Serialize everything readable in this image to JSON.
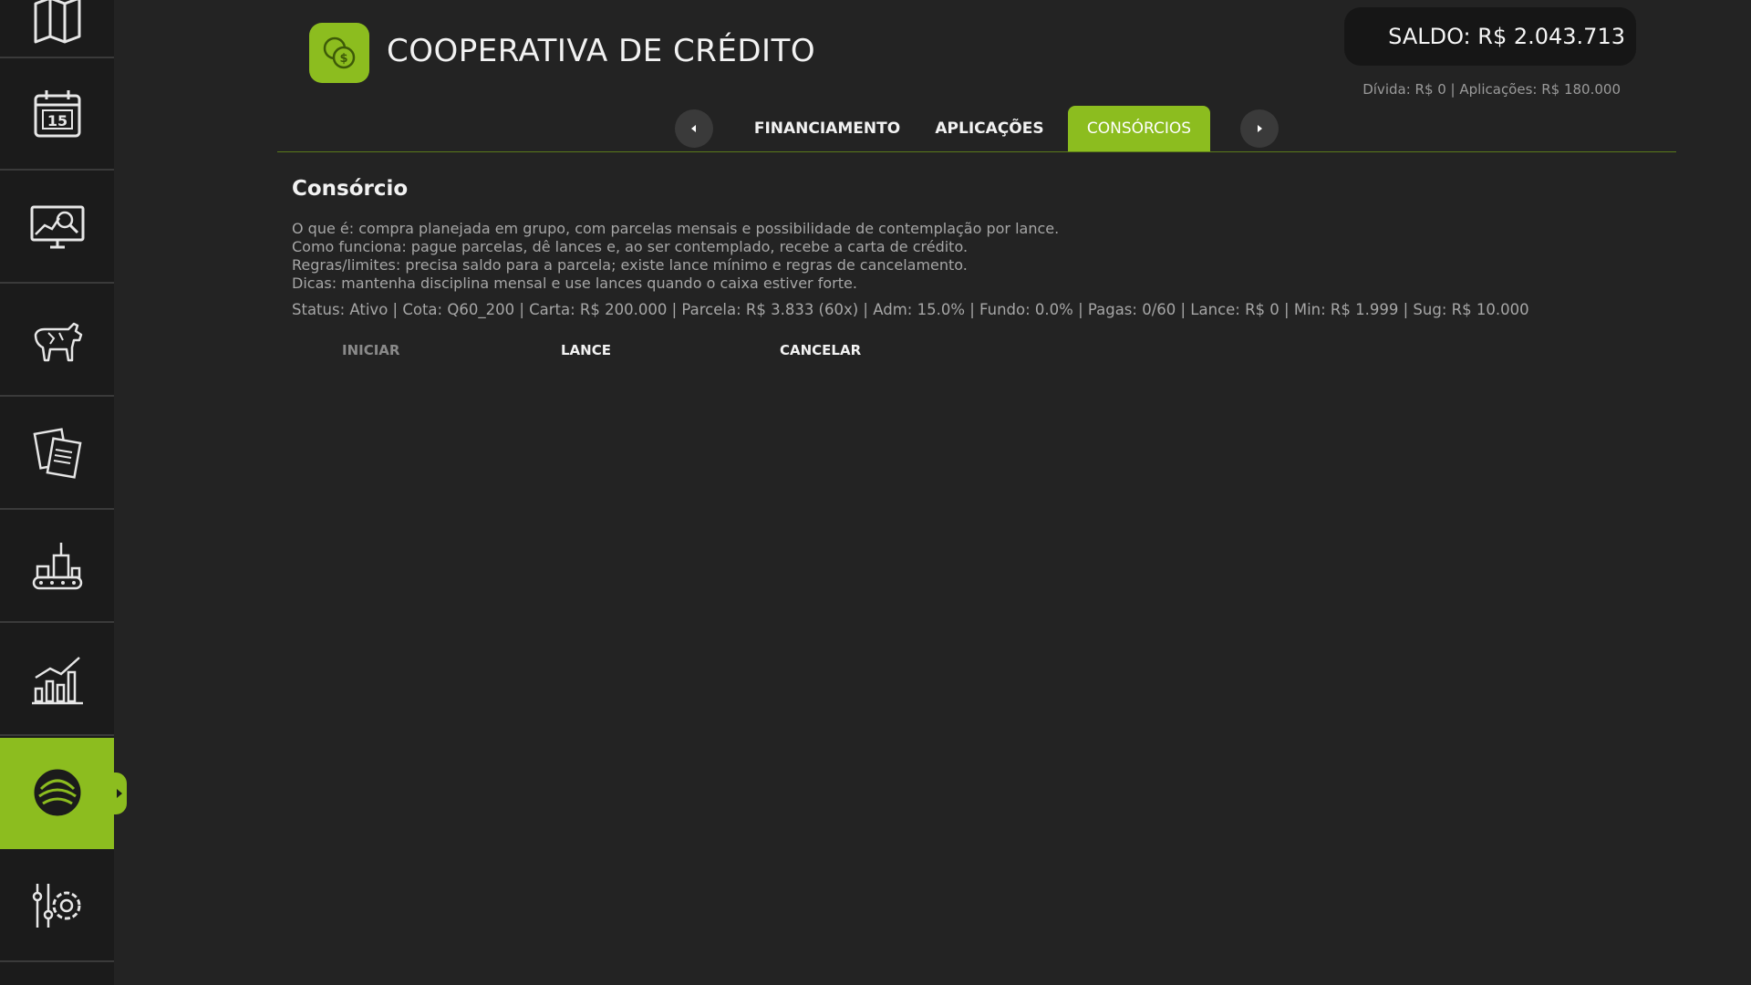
{
  "header": {
    "title": "COOPERATIVA DE CRÉDITO",
    "balance": "SALDO: R$  2.043.713",
    "balance_details": "Dívida: R$  0 | Aplicações: R$  180.000",
    "logo_icon": "coins-icon"
  },
  "colors": {
    "accent": "#8cbd1f",
    "background": "#232323",
    "sidebar": "#1b1b1b"
  },
  "sidebar": {
    "items": [
      {
        "icon": "map-icon",
        "active": false
      },
      {
        "icon": "calendar-icon",
        "active": false
      },
      {
        "icon": "monitor-analytics-icon",
        "active": false
      },
      {
        "icon": "cow-icon",
        "active": false
      },
      {
        "icon": "contracts-icon",
        "active": false
      },
      {
        "icon": "factory-icon",
        "active": false
      },
      {
        "icon": "bar-chart-icon",
        "active": false
      },
      {
        "icon": "finance-icon",
        "active": true
      },
      {
        "icon": "settings-icon",
        "active": false
      }
    ]
  },
  "tabs": {
    "items": [
      {
        "label": "FINANCIAMENTO",
        "active": false
      },
      {
        "label": "APLICAÇÕES",
        "active": false
      },
      {
        "label": "CONSÓRCIOS",
        "active": true
      }
    ]
  },
  "section": {
    "title": "Consórcio",
    "lines": [
      "O que é: compra planejada em grupo, com parcelas mensais e possibilidade de contemplação por lance.",
      "Como funciona: pague parcelas, dê lances e, ao ser contemplado, recebe a carta de crédito.",
      "Regras/limites: precisa saldo para a parcela; existe lance mínimo e regras de cancelamento.",
      "Dicas: mantenha disciplina mensal e use lances quando o caixa estiver forte."
    ],
    "status": "Status: Ativo | Cota: Q60_200 | Carta: R$  200.000 | Parcela: R$  3.833 (60x) | Adm: 15.0% | Fundo: 0.0% | Pagas: 0/60 | Lance: R$  0 | Min: R$  1.999 | Sug: R$  10.000"
  },
  "actions": {
    "start": "INICIAR",
    "bid": "LANCE",
    "cancel": "CANCELAR"
  }
}
